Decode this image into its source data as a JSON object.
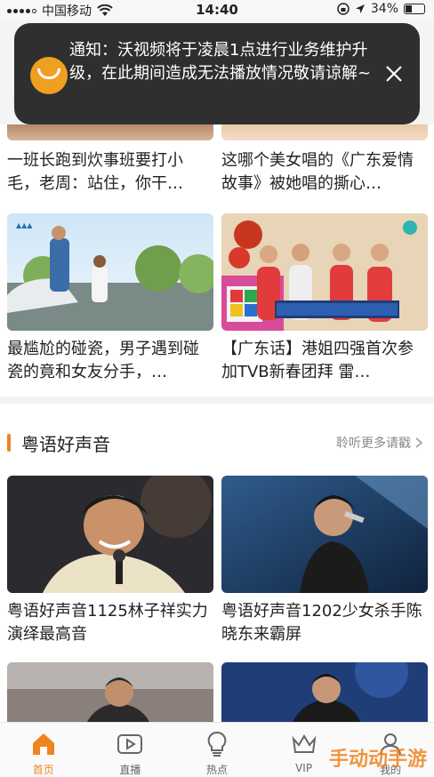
{
  "status_bar": {
    "carrier": "中国移动",
    "time": "14:40",
    "battery": "34%"
  },
  "notification": {
    "message": "通知：沃视频将于凌晨1点进行业务维护升级，在此期间造成无法播放情况敬请谅解~"
  },
  "cards_top": [
    {
      "title": "一班长跑到炊事班要打小毛，老周：站住，你干…"
    },
    {
      "title": "这哪个美女唱的《广东爱情故事》被她唱的撕心…"
    },
    {
      "title": "最尴尬的碰瓷，男子遇到碰瓷的竟和女友分手，…"
    },
    {
      "title": "【广东话】港姐四强首次参加TVB新春团拜 雷…"
    }
  ],
  "section": {
    "title": "粤语好声音",
    "more": "聆听更多请戳"
  },
  "cards_section": [
    {
      "title": "粤语好声音1125林子祥实力演绎最高音"
    },
    {
      "title": "粤语好声音1202少女杀手陈晓东来霸屏"
    }
  ],
  "tabbar": [
    {
      "label": "首页",
      "icon": "home-icon",
      "active": true
    },
    {
      "label": "直播",
      "icon": "live-icon",
      "active": false
    },
    {
      "label": "热点",
      "icon": "bulb-icon",
      "active": false
    },
    {
      "label": "VIP",
      "icon": "crown-icon",
      "active": false
    },
    {
      "label": "我的",
      "icon": "user-icon",
      "active": false
    }
  ],
  "watermark": "手动动手游",
  "colors": {
    "accent": "#f0831e",
    "notification_bg": "#2f2f2f"
  }
}
